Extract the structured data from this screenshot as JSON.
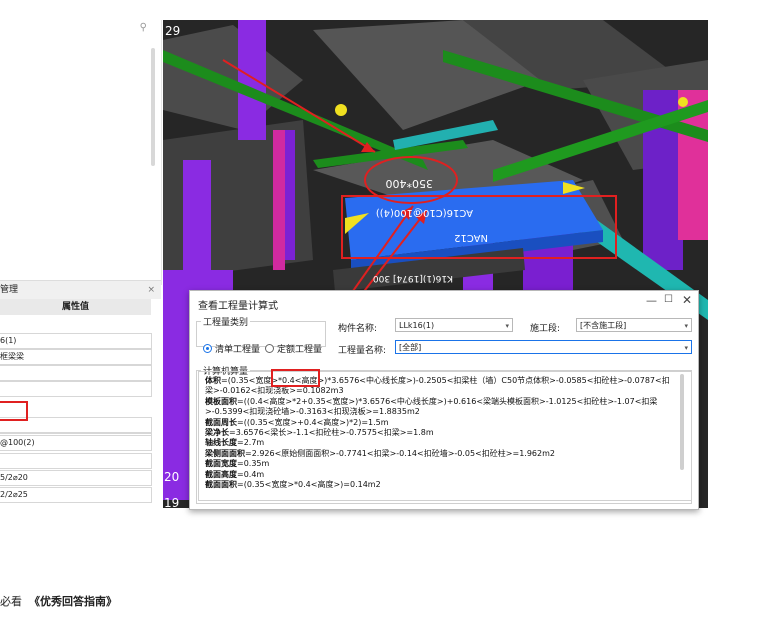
{
  "left_panel": {
    "prop_title": "管理",
    "prop_close": "×",
    "header": "属性值",
    "cells": [
      "6(1)",
      "框梁梁",
      "",
      "",
      "",
      "",
      "@100(2)",
      "",
      "5/2⌀20",
      "2/2⌀25"
    ]
  },
  "viewport": {
    "row_labels": [
      "29",
      "20",
      "19"
    ],
    "beam_texts": [
      "350*400",
      "AC16(C10@100(4))",
      "NAC12",
      "K16(1)[1974] 300"
    ]
  },
  "dialog": {
    "title": "查看工程量计算式",
    "controls": {
      "minimize": "—",
      "maximize": "☐",
      "close": "✕"
    },
    "type_group": {
      "legend": "工程量类别",
      "options": [
        {
          "label": "清单工程量",
          "selected": true
        },
        {
          "label": "定额工程量",
          "selected": false
        }
      ]
    },
    "component_label": "构件名称:",
    "component_value": "LLk16(1)",
    "segment_label": "施工段:",
    "segment_value": "[不含施工段]",
    "qty_label": "工程量名称:",
    "qty_value": "[全部]",
    "calc_legend": "计算机算量",
    "calc_lines": [
      {
        "name": "体积",
        "expr": "=(0.35<宽度>*0.4<高度>)*3.6576<中心线长度>)-0.2505<扣梁柱（墙）C50节点体积>-0.0585<扣砼柱>-0.0787<扣梁>-0.0162<扣现浇板>=0.1082m3"
      },
      {
        "name": "模板面积",
        "expr": "=((0.4<高度>*2+0.35<宽度>)*3.6576<中心线长度>)+0.616<梁端头模板面积>-1.0125<扣砼柱>-1.07<扣梁>-0.5399<扣现浇砼墙>-0.3163<扣现浇板>=1.8835m2"
      },
      {
        "name": "截面周长",
        "expr": "=((0.35<宽度>+0.4<高度>)*2)=1.5m"
      },
      {
        "name": "梁净长",
        "expr": "=3.6576<梁长>-1.1<扣砼柱>-0.7575<扣梁>=1.8m"
      },
      {
        "name": "轴线长度",
        "expr": "=2.7m"
      },
      {
        "name": "梁侧面面积",
        "expr": "=2.926<原始侧面面积>-0.7741<扣梁>-0.14<扣砼墙>-0.05<扣砼柱>=1.962m2"
      },
      {
        "name": "截面宽度",
        "expr": "=0.35m"
      },
      {
        "name": "截面高度",
        "expr": "=0.4m"
      },
      {
        "name": "截面面积",
        "expr": "=(0.35<宽度>*0.4<高度>)=0.14m2"
      }
    ]
  },
  "footer": {
    "prefix": "必看",
    "link": "《优秀回答指南》"
  },
  "colors": {
    "beam_blue": "#2a6cf0",
    "column_purple": "#8a2be2",
    "slab_gray": "#4a4a4a",
    "rebar_green": "#1c8c1c",
    "annotation_red": "#e02020"
  }
}
